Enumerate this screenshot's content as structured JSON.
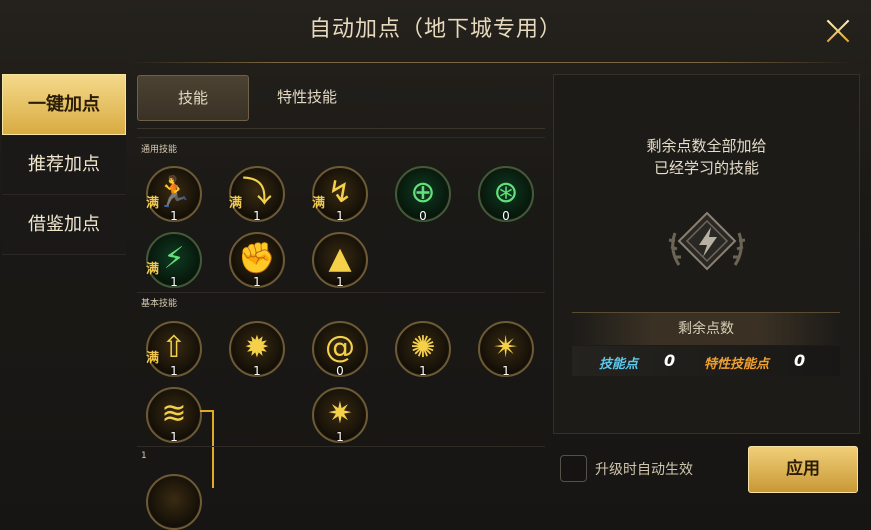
{
  "window": {
    "title": "自动加点（地下城专用）"
  },
  "left_nav": {
    "items": [
      {
        "label": "一键加点",
        "active": true
      },
      {
        "label": "推荐加点",
        "active": false
      },
      {
        "label": "借鉴加点",
        "active": false
      }
    ]
  },
  "tabs": [
    {
      "label": "技能",
      "active": true
    },
    {
      "label": "特性技能",
      "active": false
    }
  ],
  "sections": {
    "common": {
      "label": "通用技能"
    },
    "basic": {
      "label": "基本技能"
    },
    "third": {
      "label": "1"
    }
  },
  "skills": {
    "common": [
      {
        "icon": "sprint-icon",
        "full": "满",
        "level": "1"
      },
      {
        "icon": "crouch-icon",
        "full": "满",
        "level": "1"
      },
      {
        "icon": "backstep-icon",
        "full": "满",
        "level": "1"
      },
      {
        "icon": "target-crosshair-icon",
        "full": "",
        "level": "0"
      },
      {
        "icon": "target-crosshair-plus-icon",
        "full": "",
        "level": "0"
      },
      {
        "icon": "green-dash-icon",
        "full": "满",
        "level": "1"
      },
      {
        "icon": "fist-burst-icon",
        "full": "",
        "level": "1"
      },
      {
        "icon": "ground-slam-icon",
        "full": "",
        "level": "1"
      }
    ],
    "basic": [
      {
        "icon": "power-fist-up-icon",
        "full": "满",
        "level": "1"
      },
      {
        "icon": "explosion-icon",
        "full": "",
        "level": "1"
      },
      {
        "icon": "whirlwind-icon",
        "full": "",
        "level": "0"
      },
      {
        "icon": "fireball-icon",
        "full": "",
        "level": "1"
      },
      {
        "icon": "claw-strike-icon",
        "full": "",
        "level": "1"
      },
      {
        "icon": "lightning-strike-icon",
        "full": "",
        "level": "1"
      },
      {
        "icon": "shatter-icon",
        "full": "",
        "level": "1"
      }
    ]
  },
  "right_panel": {
    "line1": "剩余点数全部加给",
    "line2": "已经学习的技能",
    "emblem_icon": "lightning-emblem-icon",
    "remaining_label": "剩余点数",
    "skill_points_label": "技能点",
    "skill_points_value": "0",
    "trait_points_label": "特性技能点",
    "trait_points_value": "0"
  },
  "footer": {
    "auto_apply_label": "升级时自动生效",
    "auto_apply_checked": false,
    "apply_label": "应用"
  },
  "colors": {
    "accent": "#e0aa26",
    "skill_points": "#5ec8ee",
    "trait_points": "#f0a030"
  }
}
